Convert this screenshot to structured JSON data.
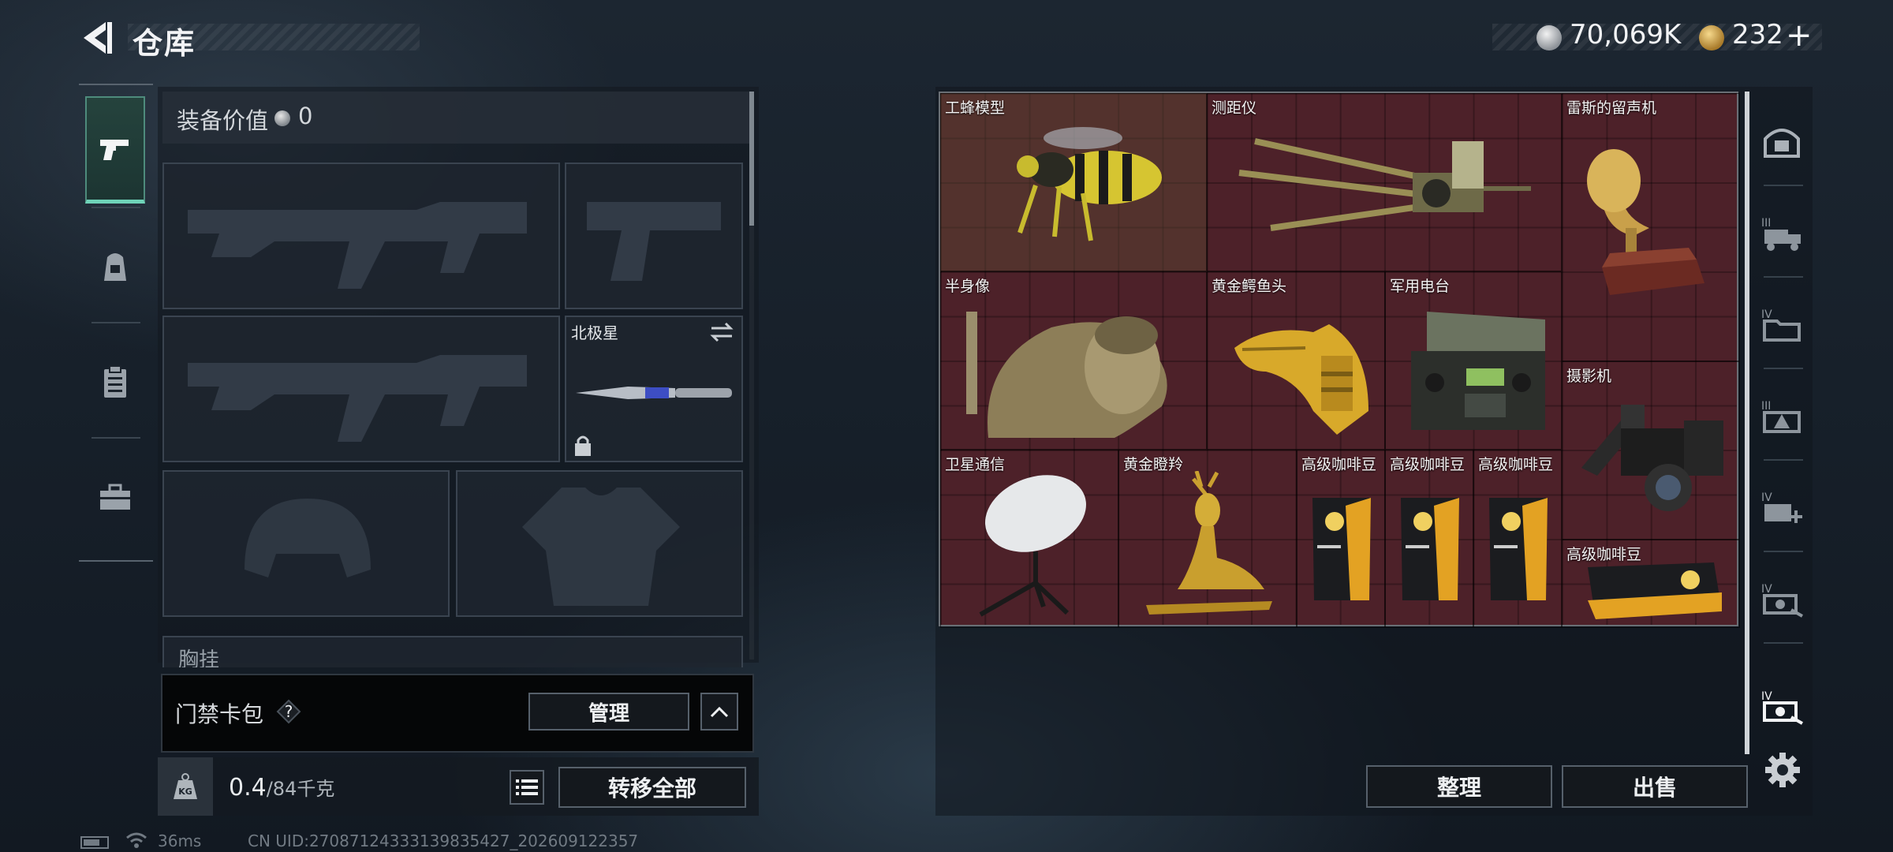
{
  "header": {
    "title": "仓库",
    "currency_primary": "70,069K",
    "currency_secondary": "232",
    "plus_label": "+"
  },
  "left_nav": {
    "items": [
      {
        "name": "weapons",
        "icon": "pistol-icon",
        "active": true
      },
      {
        "name": "backpack",
        "icon": "backpack-icon",
        "active": false
      },
      {
        "name": "vest",
        "icon": "clipboard-icon",
        "active": false
      },
      {
        "name": "toolbox",
        "icon": "briefcase-icon",
        "active": false
      }
    ]
  },
  "equipment": {
    "value_label": "装备价值",
    "value_amount": "0",
    "slots": {
      "primary_weapon_1": {
        "label": ""
      },
      "sidearm": {
        "label": ""
      },
      "primary_weapon_2": {
        "label": ""
      },
      "melee": {
        "label": "北极星"
      },
      "helmet": {
        "label": ""
      },
      "armor": {
        "label": ""
      },
      "chest_rig": {
        "label": "胸挂"
      }
    },
    "card_pack_label": "门禁卡包",
    "help_label": "?",
    "manage_label": "管理",
    "weight_value": "0.4",
    "weight_max": "/84千克",
    "kg_badge": "KG",
    "transfer_all_label": "转移全部"
  },
  "warehouse": {
    "items": [
      {
        "id": "wasp",
        "label": "工蜂模型"
      },
      {
        "id": "rangefinder",
        "label": "测距仪"
      },
      {
        "id": "gramophone",
        "label": "雷斯的留声机"
      },
      {
        "id": "bust",
        "label": "半身像"
      },
      {
        "id": "croc",
        "label": "黄金鳄鱼头"
      },
      {
        "id": "radio",
        "label": "军用电台"
      },
      {
        "id": "camera",
        "label": "摄影机"
      },
      {
        "id": "satellite",
        "label": "卫星通信"
      },
      {
        "id": "deer",
        "label": "黄金瞪羚"
      },
      {
        "id": "coffee1",
        "label": "高级咖啡豆"
      },
      {
        "id": "coffee2",
        "label": "高级咖啡豆"
      },
      {
        "id": "coffee3",
        "label": "高级咖啡豆"
      },
      {
        "id": "coffee4",
        "label": "高级咖啡豆"
      }
    ],
    "sort_label": "整理",
    "sell_label": "出售"
  },
  "right_nav": {
    "items": [
      {
        "icon": "vault-icon"
      },
      {
        "icon": "storage-iii-truck-icon"
      },
      {
        "icon": "storage-iv-folder-icon"
      },
      {
        "icon": "storage-iii-warning-icon"
      },
      {
        "icon": "storage-iv-add-icon"
      },
      {
        "icon": "storage-iv-tools-icon"
      },
      {
        "icon": "storage-iv-tools-active-icon"
      }
    ]
  },
  "status": {
    "ping": "36ms",
    "uid": "CN UID:27087124333139835427_202609122357"
  }
}
